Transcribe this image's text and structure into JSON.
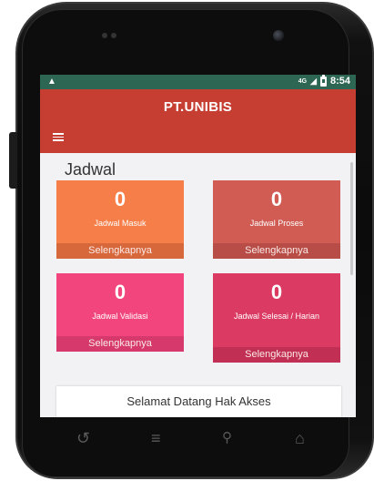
{
  "status_bar": {
    "alert_icon": "warning-icon",
    "signal_label": "4G",
    "time": "8:54"
  },
  "app_bar": {
    "title": "PT.UNIBIS",
    "menu_icon": "hamburger-icon"
  },
  "section": {
    "title": "Jadwal"
  },
  "tiles": [
    {
      "count": "0",
      "label": "Jadwal Masuk",
      "more": "Selengkapnya",
      "color": "#f57e49"
    },
    {
      "count": "0",
      "label": "Jadwal Proses",
      "more": "Selengkapnya",
      "color": "#d05c54"
    },
    {
      "count": "0",
      "label": "Jadwal Validasi",
      "more": "Selengkapnya",
      "color": "#f2457e"
    },
    {
      "count": "0",
      "label": "Jadwal Selesai / Harian",
      "more": "Selengkapnya",
      "color": "#db3b63"
    }
  ],
  "welcome": {
    "text": "Selamat Datang Hak Akses"
  },
  "nav": {
    "back_icon": "back-icon",
    "menu_icon": "menu-icon",
    "search_icon": "search-icon",
    "home_icon": "home-icon"
  },
  "colors": {
    "status_bar": "#2d6652",
    "app_bar": "#c63d31",
    "background": "#f2f2f5"
  }
}
